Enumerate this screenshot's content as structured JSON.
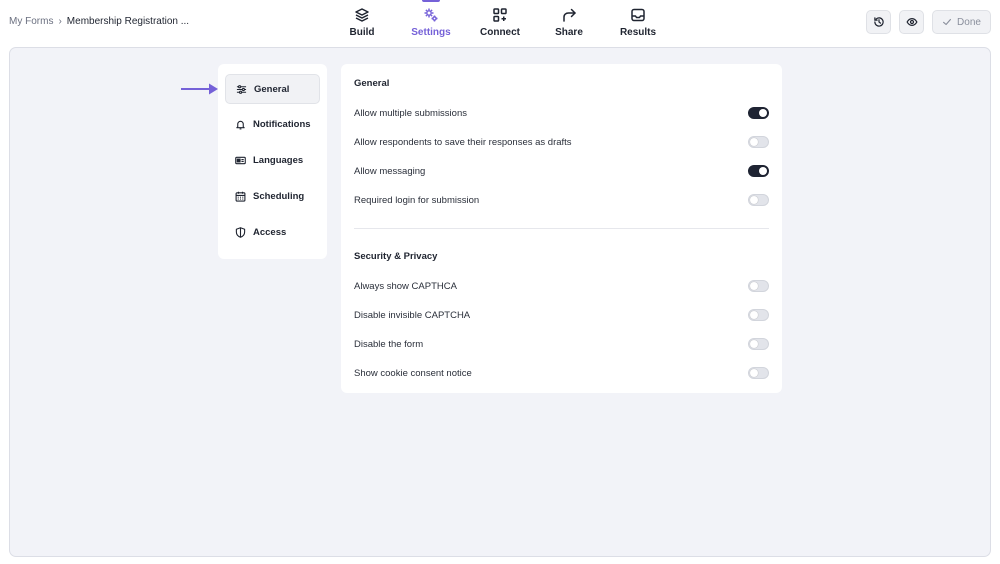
{
  "breadcrumb": {
    "root": "My Forms",
    "separator": "›",
    "current": "Membership Registration ..."
  },
  "tabs": [
    {
      "label": "Build",
      "icon": "layers-icon",
      "active": false
    },
    {
      "label": "Settings",
      "icon": "gears-icon",
      "active": true
    },
    {
      "label": "Connect",
      "icon": "grid-plus-icon",
      "active": false
    },
    {
      "label": "Share",
      "icon": "share-arrow-icon",
      "active": false
    },
    {
      "label": "Results",
      "icon": "inbox-icon",
      "active": false
    }
  ],
  "toolbar": {
    "done_label": "Done"
  },
  "sidebar": {
    "items": [
      {
        "label": "General",
        "icon": "sliders-icon",
        "active": true
      },
      {
        "label": "Notifications",
        "icon": "bell-icon",
        "active": false
      },
      {
        "label": "Languages",
        "icon": "language-card-icon",
        "active": false
      },
      {
        "label": "Scheduling",
        "icon": "calendar-icon",
        "active": false
      },
      {
        "label": "Access",
        "icon": "shield-icon",
        "active": false
      }
    ]
  },
  "general": {
    "title": "General",
    "options": [
      {
        "label": "Allow multiple submissions",
        "on": true
      },
      {
        "label": "Allow respondents to save their responses as drafts",
        "on": false
      },
      {
        "label": "Allow messaging",
        "on": true
      },
      {
        "label": "Required login for submission",
        "on": false
      }
    ]
  },
  "security": {
    "title": "Security & Privacy",
    "options": [
      {
        "label": "Always show CAPTHCA",
        "on": false
      },
      {
        "label": "Disable invisible CAPTCHA",
        "on": false
      },
      {
        "label": "Disable the form",
        "on": false
      },
      {
        "label": "Show cookie consent notice",
        "on": false
      }
    ]
  },
  "colors": {
    "accent": "#7561d8",
    "toggle_on": "#1f2433",
    "canvas": "#f2f3f8"
  }
}
